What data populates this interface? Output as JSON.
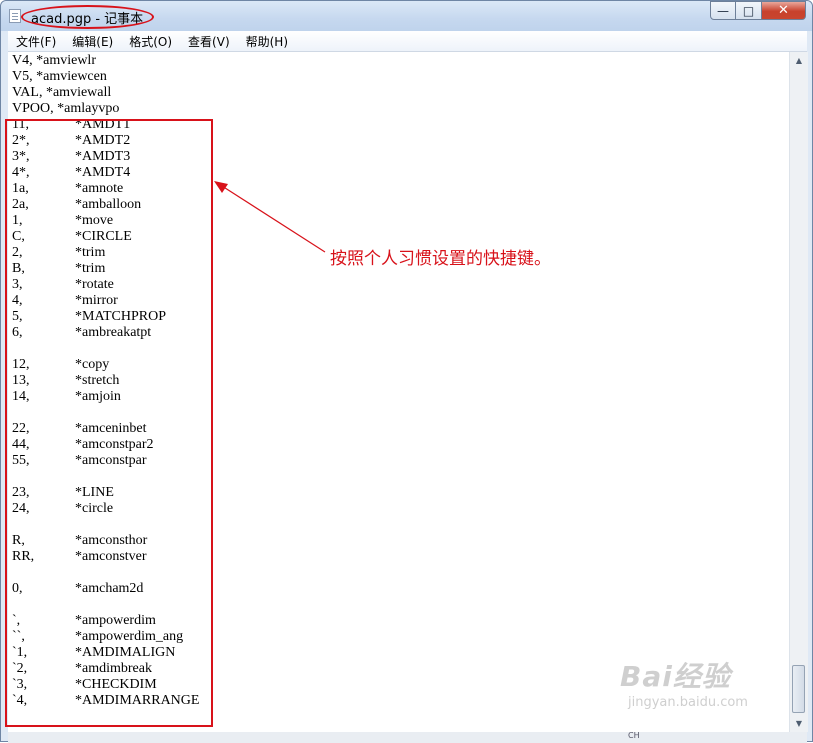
{
  "window": {
    "title": "acad.pgp - 记事本",
    "minimize_label": "—",
    "maximize_label": "□",
    "close_label": "✕"
  },
  "menu": [
    {
      "label": "文件(F)"
    },
    {
      "label": "编辑(E)"
    },
    {
      "label": "格式(O)"
    },
    {
      "label": "查看(V)"
    },
    {
      "label": "帮助(H)"
    }
  ],
  "content": {
    "lines": [
      {
        "text": "V4, *amviewlr"
      },
      {
        "text": "V5, *amviewcen"
      },
      {
        "text": "VAL, *amviewall"
      },
      {
        "text": "VPOO, *amlayvpo"
      },
      {
        "key": "11,",
        "cmd": "*AMDT1"
      },
      {
        "key": "2*,",
        "cmd": "*AMDT2"
      },
      {
        "key": "3*,",
        "cmd": "*AMDT3"
      },
      {
        "key": "4*,",
        "cmd": "*AMDT4"
      },
      {
        "key": "1a,",
        "cmd": "*amnote"
      },
      {
        "key": "2a,",
        "cmd": "*amballoon"
      },
      {
        "key": "1,",
        "cmd": "*move"
      },
      {
        "key": "C,",
        "cmd": "*CIRCLE"
      },
      {
        "key": "2,",
        "cmd": "*trim"
      },
      {
        "key": "B,",
        "cmd": "*trim"
      },
      {
        "key": "3,",
        "cmd": "*rotate"
      },
      {
        "key": "4,",
        "cmd": "*mirror"
      },
      {
        "key": "5,",
        "cmd": "*MATCHPROP"
      },
      {
        "key": "6,",
        "cmd": "*ambreakatpt"
      },
      {
        "text": ""
      },
      {
        "key": "12,",
        "cmd": "*copy"
      },
      {
        "key": "13,",
        "cmd": "*stretch"
      },
      {
        "key": "14,",
        "cmd": "*amjoin"
      },
      {
        "text": ""
      },
      {
        "key": "22,",
        "cmd": "*amceninbet"
      },
      {
        "key": "44,",
        "cmd": "*amconstpar2"
      },
      {
        "key": "55,",
        "cmd": "*amconstpar"
      },
      {
        "text": ""
      },
      {
        "key": "23,",
        "cmd": "*LINE"
      },
      {
        "key": "24,",
        "cmd": "*circle"
      },
      {
        "text": ""
      },
      {
        "key": "R,",
        "cmd": "*amconsthor"
      },
      {
        "key": "RR,",
        "cmd": "*amconstver"
      },
      {
        "text": ""
      },
      {
        "key": "0,",
        "cmd": "*amcham2d"
      },
      {
        "text": ""
      },
      {
        "key": "`,",
        "cmd": "*ampowerdim"
      },
      {
        "key": "``,",
        "cmd": "*ampowerdim_ang"
      },
      {
        "key": "`1,",
        "cmd": "*AMDIMALIGN"
      },
      {
        "key": "`2,",
        "cmd": "*amdimbreak"
      },
      {
        "key": "`3,",
        "cmd": "*CHECKDIM"
      },
      {
        "key": "`4,",
        "cmd": "*AMDIMARRANGE"
      }
    ]
  },
  "annotation": {
    "text": "按照个人习惯设置的快捷键。",
    "color": "#d8121a"
  },
  "watermark": {
    "logo": "Bai经验",
    "url": "jingyan.baidu.com"
  },
  "status": {
    "ime": "CH"
  },
  "colors": {
    "annotation_red": "#d8121a",
    "titlebar": "#c6d8ef",
    "close_button": "#c8412c"
  }
}
